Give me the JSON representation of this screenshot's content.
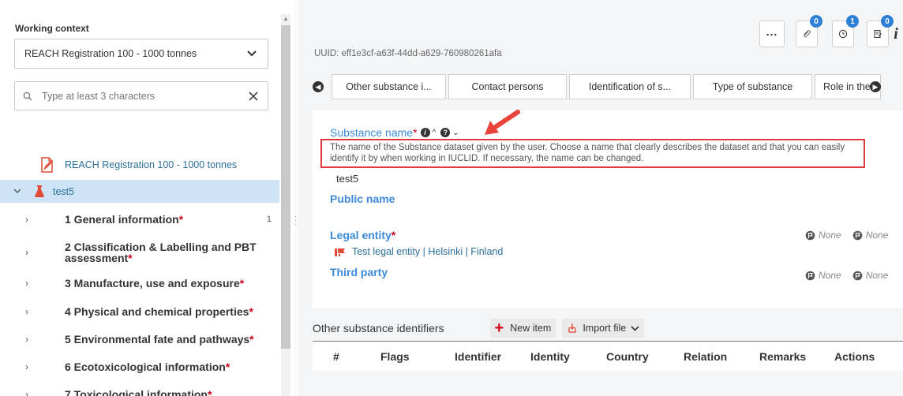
{
  "left": {
    "working_context_label": "Working context",
    "working_context_value": "REACH Registration 100 - 1000 tonnes",
    "search_placeholder": "Type at least 3 characters",
    "tree_root_label": "REACH Registration 100 - 1000 tonnes",
    "selected_label": "test5",
    "items": [
      {
        "label": "1 General information",
        "required": "*",
        "count": "1"
      },
      {
        "label": "2 Classification & Labelling and PBT assessment",
        "required": "*",
        "count": ""
      },
      {
        "label": "3 Manufacture, use and exposure",
        "required": "*",
        "count": ""
      },
      {
        "label": "4 Physical and chemical properties",
        "required": "*",
        "count": ""
      },
      {
        "label": "5 Environmental fate and pathways",
        "required": "*",
        "count": ""
      },
      {
        "label": "6 Ecotoxicological information",
        "required": "*",
        "count": ""
      },
      {
        "label": "7 Toxicological information",
        "required": "*",
        "count": ""
      }
    ]
  },
  "toolbar": {
    "more_label": "...",
    "attachments_badge": "0",
    "history_badge": "1",
    "annotations_badge": "0",
    "info_label": "i"
  },
  "main": {
    "uuid": "UUID: eff1e3cf-a63f-44dd-a629-760980261afa",
    "tabs": [
      "Other substance i...",
      "Contact persons",
      "Identification of s...",
      "Type of substance",
      "Role in the"
    ],
    "substance_name_label": "Substance name",
    "required_mark": "*",
    "help_text": "The name of the Substance dataset given by the user. Choose a name that clearly describes the dataset and that you can easily identify it by when working in IUCLID. If necessary, the name can be changed.",
    "substance_name_value": "test5",
    "public_name_label": "Public name",
    "legal_entity_label": "Legal entity",
    "legal_entity_value": "Test legal entity | Helsinki | Finland",
    "third_party_label": "Third party",
    "none_label": "None"
  },
  "identifiers": {
    "title": "Other substance identifiers",
    "new_item_label": "New item",
    "import_file_label": "Import file",
    "columns": [
      "#",
      "Flags",
      "Identifier",
      "Identity",
      "Country",
      "Relation",
      "Remarks",
      "Actions"
    ]
  },
  "colors": {
    "accent": "#3b8ad9",
    "required": "#d0021b",
    "selection": "#cde4f7",
    "highlight_box": "#e0393e",
    "badge": "#2e7fd6"
  }
}
